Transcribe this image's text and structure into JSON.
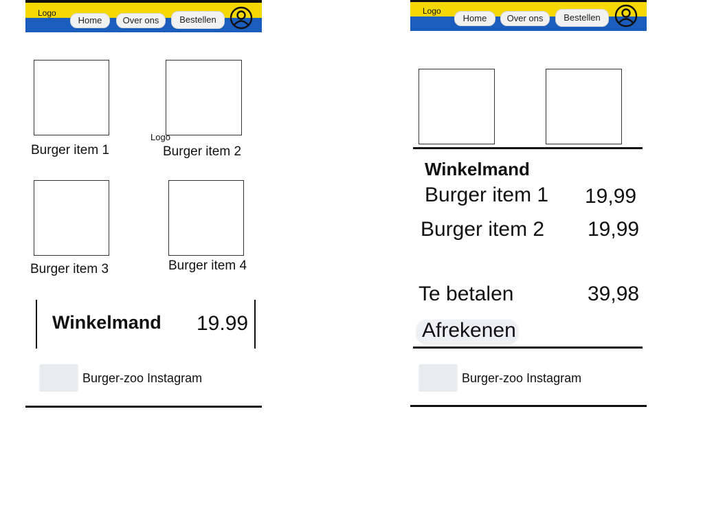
{
  "left": {
    "header": {
      "logo": "Logo",
      "nav": [
        "Home",
        "Over ons",
        "Bestellen"
      ],
      "profile_icon": "user-circle-icon"
    },
    "products": [
      {
        "label": "Burger item 1"
      },
      {
        "label": "Burger item 2"
      },
      {
        "label": "Burger item 3"
      },
      {
        "label": "Burger item 4"
      }
    ],
    "stray_logo": "Logo",
    "cart": {
      "title": "Winkelmand",
      "total": "19.99"
    },
    "instagram": {
      "label": "Burger-zoo Instagram"
    }
  },
  "right": {
    "header": {
      "logo": "Logo",
      "nav": [
        "Home",
        "Over ons",
        "Bestellen"
      ],
      "profile_icon": "user-circle-icon"
    },
    "cart": {
      "title": "Winkelmand",
      "items": [
        {
          "name": "Burger item 1",
          "price": "19,99"
        },
        {
          "name": "Burger item 2",
          "price": "19,99"
        }
      ],
      "total_label": "Te betalen",
      "total_value": "39,98",
      "checkout_label": "Afrekenen"
    },
    "instagram": {
      "label": "Burger-zoo Instagram"
    }
  },
  "colors": {
    "yellow": "#f5d800",
    "blue": "#1a5dbd",
    "black": "#111111"
  }
}
